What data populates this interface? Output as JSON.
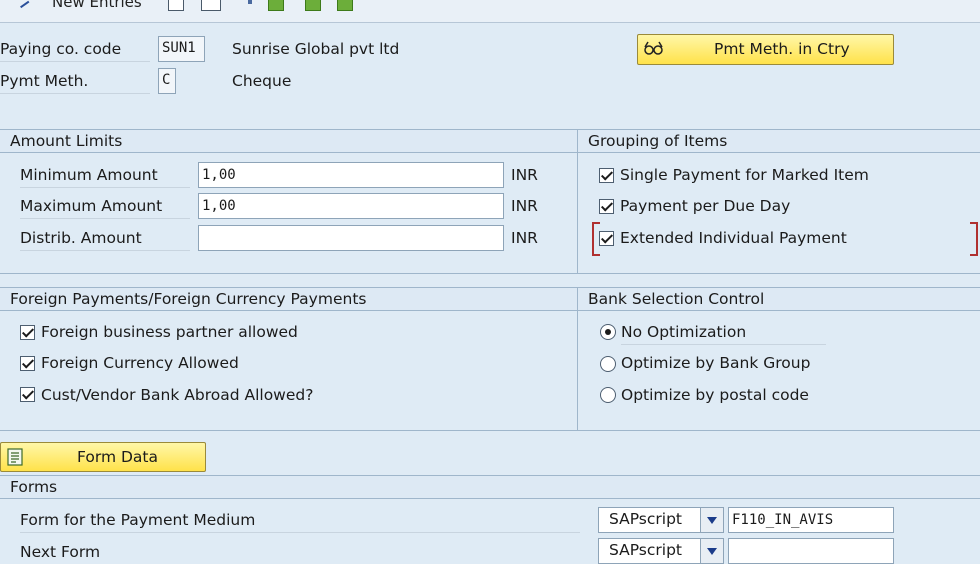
{
  "toolbar": {
    "new_entries_label": "New Entries"
  },
  "header": {
    "company_code_label": "Paying co. code",
    "company_code_value": "SUN1",
    "company_name": "Sunrise Global pvt ltd",
    "payment_method_label": "Pymt Meth.",
    "payment_method_value": "C",
    "payment_method_text": "Cheque",
    "pmt_meth_button": "Pmt Meth. in Ctry"
  },
  "amount_limits": {
    "title": "Amount Limits",
    "minimum_label": "Minimum Amount",
    "minimum_value": "1,00",
    "maximum_label": "Maximum Amount",
    "maximum_value": "1,00",
    "distrib_label": "Distrib. Amount",
    "distrib_value": "",
    "currency": "INR"
  },
  "grouping": {
    "title": "Grouping of Items",
    "items": [
      {
        "label": "Single Payment for Marked Item",
        "checked": true
      },
      {
        "label": "Payment per Due Day",
        "checked": true
      },
      {
        "label": "Extended Individual Payment",
        "checked": true
      }
    ]
  },
  "foreign_payments": {
    "title": "Foreign Payments/Foreign Currency Payments",
    "items": [
      {
        "label": "Foreign business partner allowed",
        "checked": true
      },
      {
        "label": "Foreign Currency Allowed",
        "checked": true
      },
      {
        "label": "Cust/Vendor Bank Abroad Allowed?",
        "checked": true
      }
    ]
  },
  "bank_selection": {
    "title": "Bank Selection Control",
    "options": [
      {
        "label": "No Optimization",
        "selected": true
      },
      {
        "label": "Optimize by Bank Group",
        "selected": false
      },
      {
        "label": "Optimize by postal code",
        "selected": false
      }
    ]
  },
  "form_data_button": "Form Data",
  "forms": {
    "title": "Forms",
    "payment_medium_label": "Form for the Payment Medium",
    "payment_medium_type": "SAPscript",
    "payment_medium_value": "F110_IN_AVIS",
    "next_form_label": "Next Form",
    "next_form_type": "SAPscript",
    "next_form_value": ""
  },
  "colors": {
    "background": "#dfebf5",
    "button_yellow": "#ffe24a",
    "border": "#9fb6cb"
  }
}
